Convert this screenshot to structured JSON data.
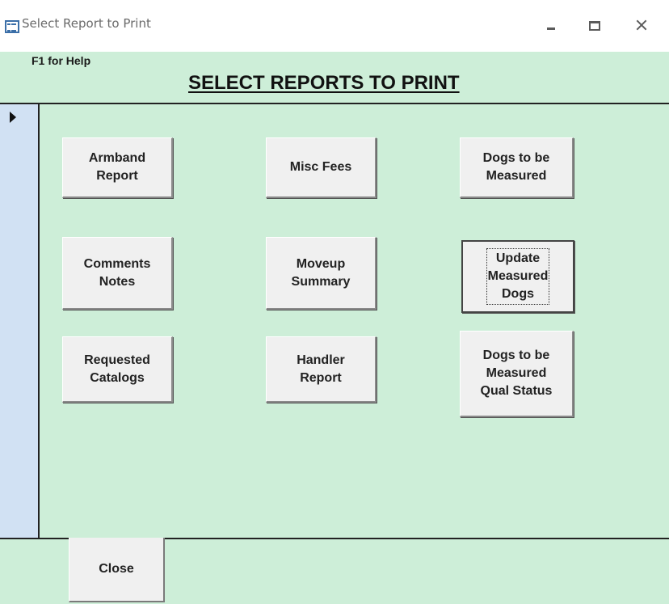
{
  "window": {
    "title": "Select Report to Print",
    "controls": {
      "minimize_icon": "minimize-icon",
      "maximize_icon": "maximize-icon",
      "close_icon": "close-icon"
    }
  },
  "header": {
    "help_text": "F1 for Help",
    "title": "SELECT REPORTS TO PRINT"
  },
  "buttons": {
    "armband_report": "Armband\nReport",
    "misc_fees": "Misc Fees",
    "dogs_to_be_measured": "Dogs to be\nMeasured",
    "comments_notes": "Comments\nNotes",
    "moveup_summary": "Moveup\nSummary",
    "update_measured_dogs": "Update\nMeasured\nDogs",
    "requested_catalogs": "Requested\nCatalogs",
    "handler_report": "Handler\nReport",
    "dogs_measured_qual_status": "Dogs to be\nMeasured\nQual Status"
  },
  "footer": {
    "close_label": "Close"
  },
  "colors": {
    "form_background": "#cdeed8",
    "record_selector": "#d1e1f3",
    "button_face": "#f0f0f0"
  }
}
